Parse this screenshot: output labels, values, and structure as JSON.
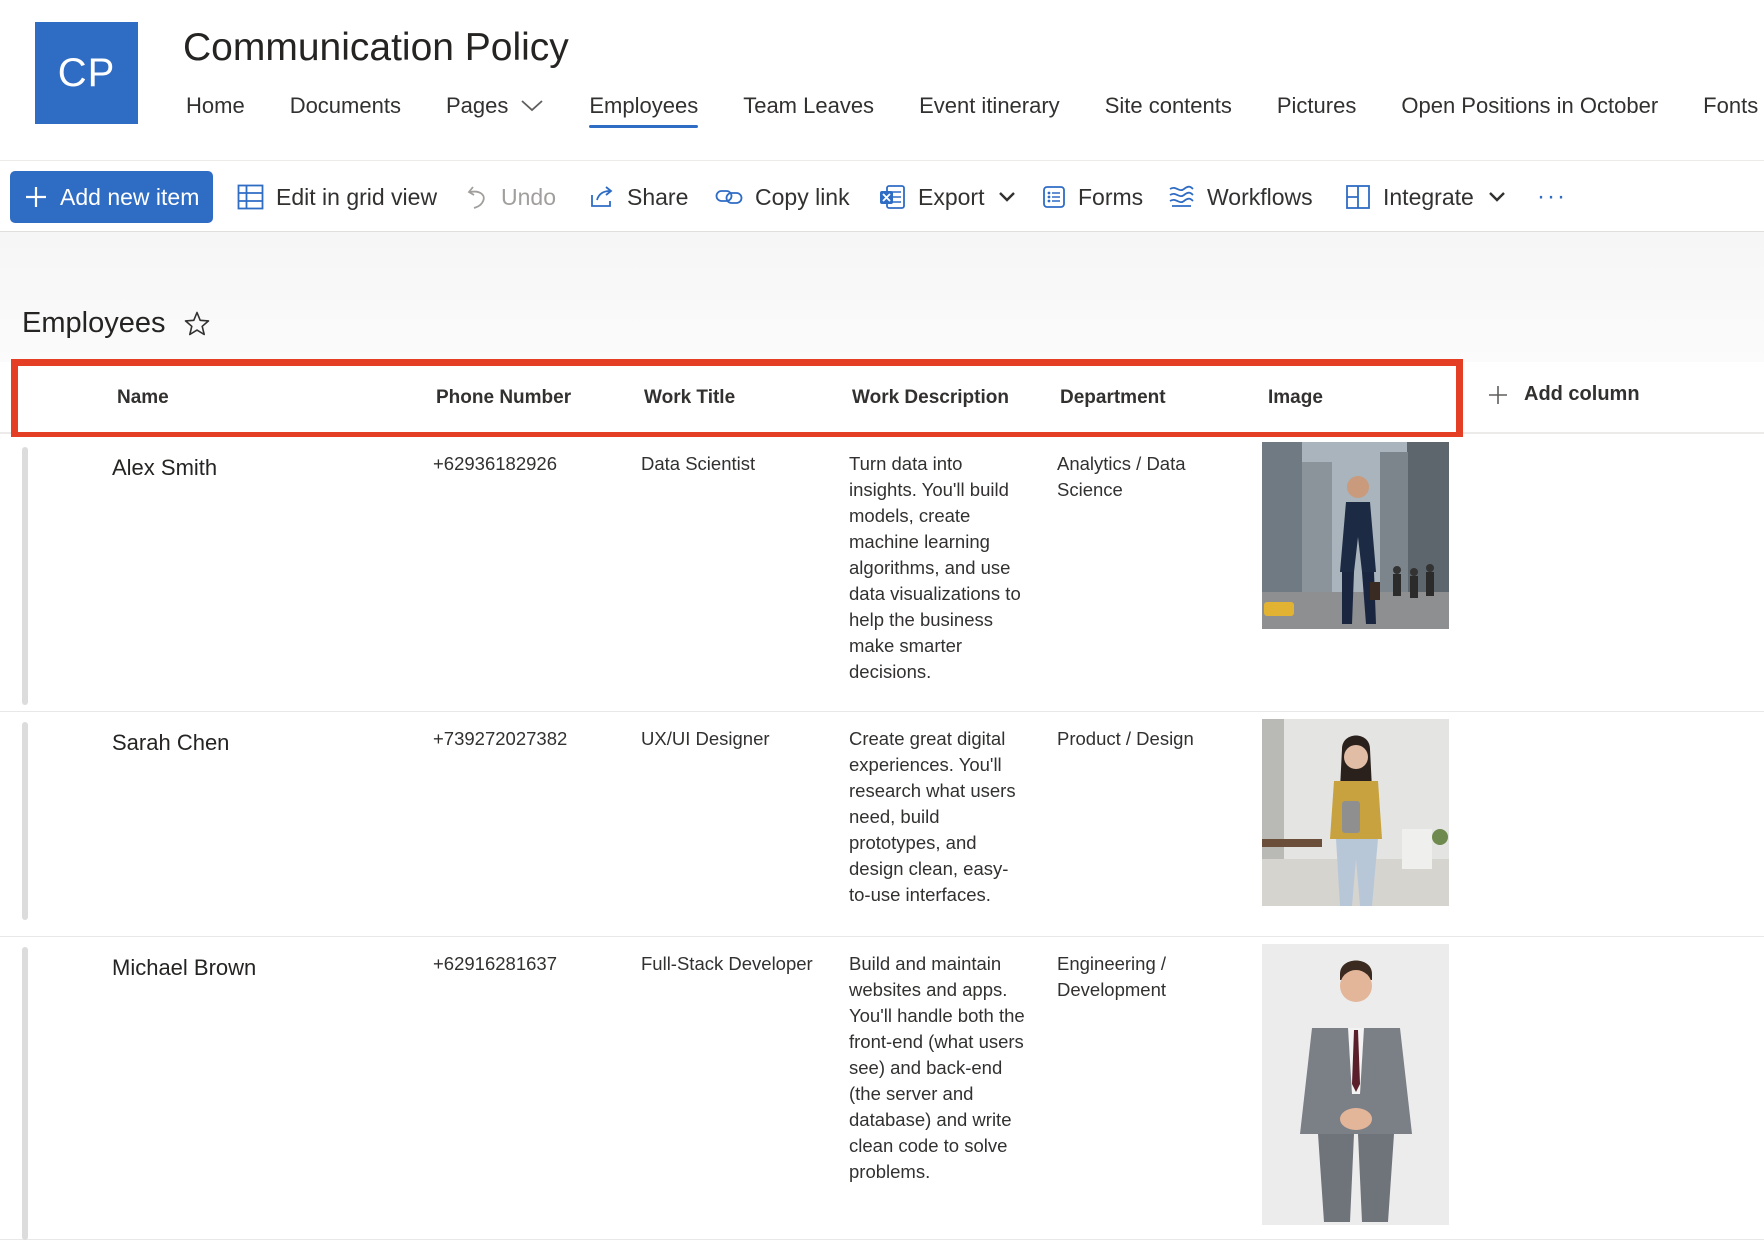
{
  "site": {
    "logo_text": "CP",
    "title": "Communication Policy",
    "nav": [
      "Home",
      "Documents",
      "Pages",
      "Employees",
      "Team Leaves",
      "Event itinerary",
      "Site contents",
      "Pictures",
      "Open Positions in October",
      "Fonts"
    ],
    "active_nav": "Employees"
  },
  "commands": {
    "add_new_item": "Add new item",
    "edit_grid": "Edit in grid view",
    "undo": "Undo",
    "share": "Share",
    "copy_link": "Copy link",
    "export": "Export",
    "forms": "Forms",
    "workflows": "Workflows",
    "integrate": "Integrate",
    "more": "···"
  },
  "list": {
    "title": "Employees",
    "columns": [
      "Name",
      "Phone Number",
      "Work Title",
      "Work Description",
      "Department",
      "Image"
    ],
    "add_column": "Add column",
    "rows": [
      {
        "name": "Alex Smith",
        "phone": "+62936182926",
        "title": "Data Scientist",
        "description": "Turn data into insights. You'll build models, create machine learning algorithms, and use data visualizations to help the business make smarter decisions.",
        "department": "Analytics / Data Science"
      },
      {
        "name": "Sarah Chen",
        "phone": "+739272027382",
        "title": "UX/UI Designer",
        "description": "Create great digital experiences. You'll research what users need, build prototypes, and design clean, easy-to-use interfaces.",
        "department": "Product / Design"
      },
      {
        "name": "Michael Brown",
        "phone": "+62916281637",
        "title": "Full-Stack Developer",
        "description": "Build and maintain websites and apps. You'll handle both the front-end (what users see) and back-end (the server and database) and write clean code to solve problems.",
        "department": "Engineering / Development"
      }
    ]
  },
  "colors": {
    "accent": "#2f6cc4",
    "highlight_border": "#e43e24"
  }
}
